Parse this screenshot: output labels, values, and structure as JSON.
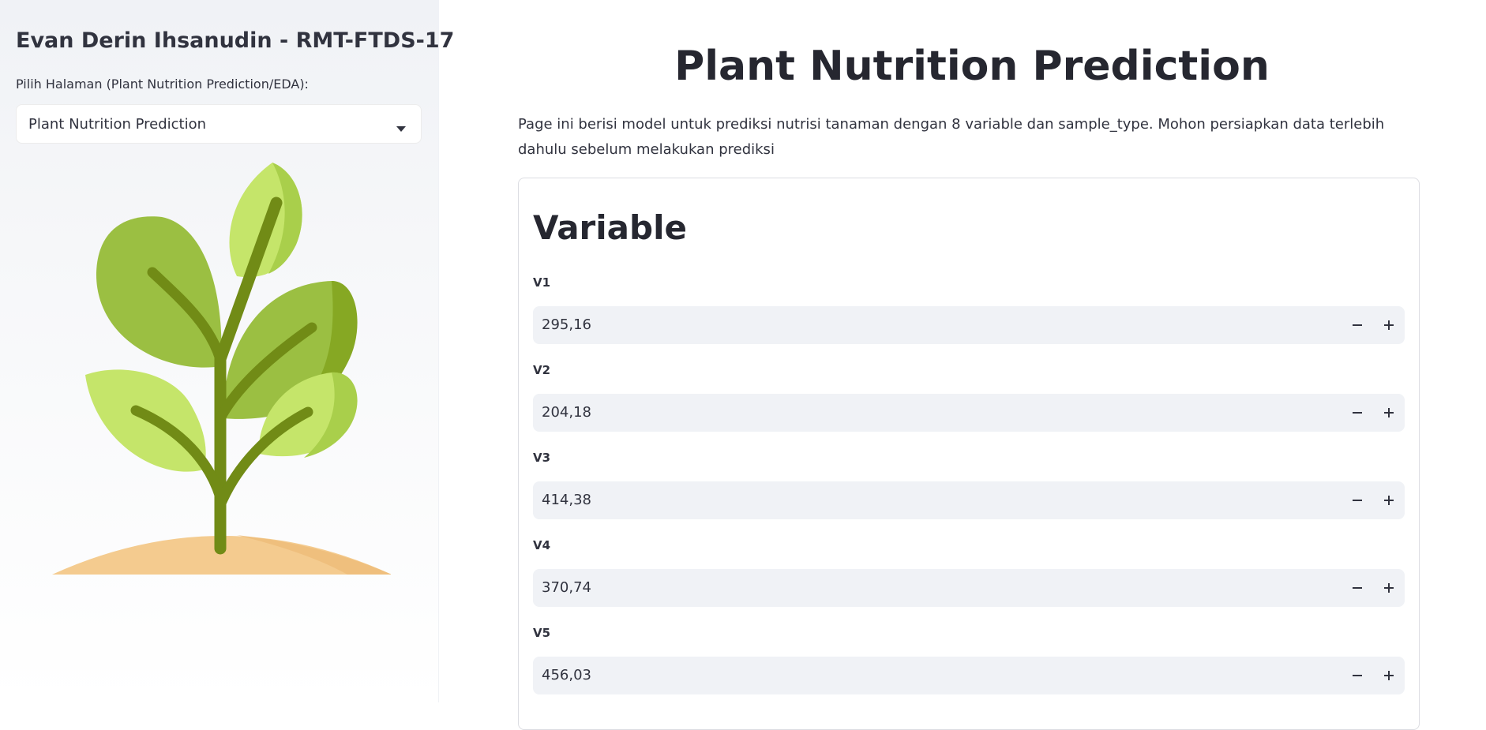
{
  "sidebar": {
    "title": "Evan Derin Ihsanudin - RMT-FTDS-17",
    "select_label": "Pilih Halaman (Plant Nutrition Prediction/EDA):",
    "select_value": "Plant Nutrition Prediction"
  },
  "main": {
    "title": "Plant Nutrition Prediction",
    "description": "Page ini berisi model untuk prediksi nutrisi tanaman dengan 8 variable dan sample_type. Mohon persiapkan data terlebih dahulu sebelum melakukan prediksi",
    "form": {
      "title": "Variable",
      "fields": [
        {
          "label": "V1",
          "value": "295,16"
        },
        {
          "label": "V2",
          "value": "204,18"
        },
        {
          "label": "V3",
          "value": "414,38"
        },
        {
          "label": "V4",
          "value": "370,74"
        },
        {
          "label": "V5",
          "value": "456,03"
        }
      ]
    }
  },
  "icons": {
    "select_arrow": "chevron-down-icon",
    "decrement": "minus-icon",
    "increment": "plus-icon",
    "illustration": "plant-sprout-illustration"
  },
  "colors": {
    "sidebar_bg": "#f0f2f6",
    "input_bg": "#f0f2f6",
    "text": "#31333f",
    "heading": "#262730",
    "leaf_dark": "#9bbf42",
    "leaf_light": "#c5e56a",
    "stem": "#718b16",
    "soil": "#f4cb8f"
  }
}
